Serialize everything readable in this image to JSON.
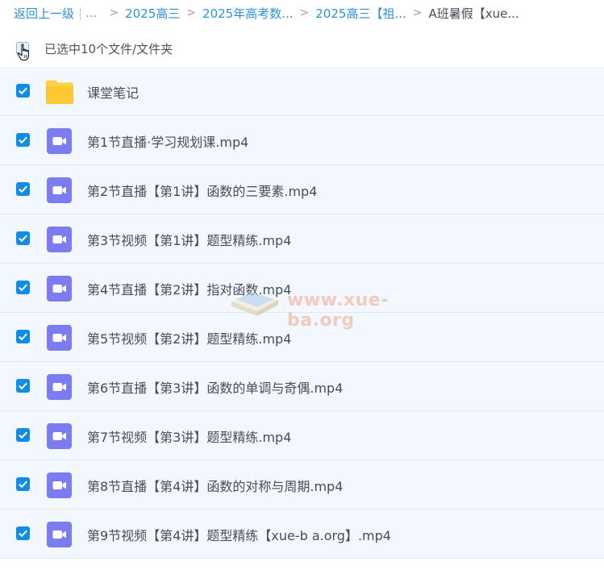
{
  "breadcrumb": {
    "back_label": "返回上一级",
    "ellipsis": "...",
    "items": [
      "2025高三",
      "2025年高考数...",
      "2025高三【祖...",
      "A班暑假【xue..."
    ]
  },
  "selection": {
    "count_label": "已选中10个文件/文件夹"
  },
  "files": [
    {
      "name": "课堂笔记",
      "type": "folder"
    },
    {
      "name": "第1节直播·学习规划课.mp4",
      "type": "video"
    },
    {
      "name": "第2节直播【第1讲】函数的三要素.mp4",
      "type": "video"
    },
    {
      "name": "第3节视频【第1讲】题型精练.mp4",
      "type": "video"
    },
    {
      "name": "第4节直播【第2讲】指对函数.mp4",
      "type": "video"
    },
    {
      "name": "第5节视频【第2讲】题型精练.mp4",
      "type": "video"
    },
    {
      "name": "第6节直播【第3讲】函数的单调与奇偶.mp4",
      "type": "video"
    },
    {
      "name": "第7节视频【第3讲】题型精练.mp4",
      "type": "video"
    },
    {
      "name": "第8节直播【第4讲】函数的对称与周期.mp4",
      "type": "video"
    },
    {
      "name": "第9节视频【第4讲】题型精练【xue-b a.org】.mp4",
      "type": "video"
    }
  ],
  "watermark": {
    "text": "www.xue-ba.org"
  },
  "colors": {
    "link": "#2e92d7",
    "checkbox": "#0f8de6",
    "row_bg": "#f2f8fd",
    "folder": "#fdd04c",
    "video": "#7a7cf0"
  },
  "icons": {
    "folder": "folder-icon",
    "video": "video-file-icon",
    "check": "checkmark-icon",
    "cursor": "hand-cursor-icon"
  }
}
